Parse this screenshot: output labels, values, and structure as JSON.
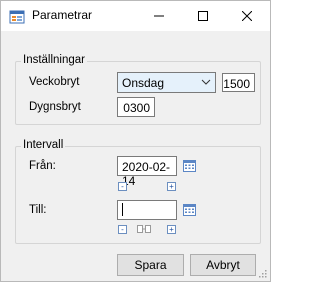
{
  "window": {
    "title": "Parametrar",
    "icon": "form-icon",
    "controls": {
      "minimize": "minimize-icon",
      "maximize": "maximize-icon",
      "close": "close-icon"
    }
  },
  "installningar": {
    "group_label": "Inställningar",
    "veckobryt_label": "Veckobryt",
    "veckobryt_day": "Onsdag",
    "veckobryt_time": "1500",
    "dygnsbryt_label": "Dygnsbryt",
    "dygnsbryt_time": "0300"
  },
  "intervall": {
    "group_label": "Intervall",
    "fran_label": "Från:",
    "fran_value": "2020-02-14",
    "till_label": "Till:",
    "till_value": "",
    "minus_symbol": "-",
    "plus_symbol": "+"
  },
  "buttons": {
    "save": "Spara",
    "cancel": "Avbryt"
  },
  "colors": {
    "window_bg": "#f0f0f0",
    "select_bg": "#e5f1fb",
    "button_bg": "#e1e1e1"
  }
}
